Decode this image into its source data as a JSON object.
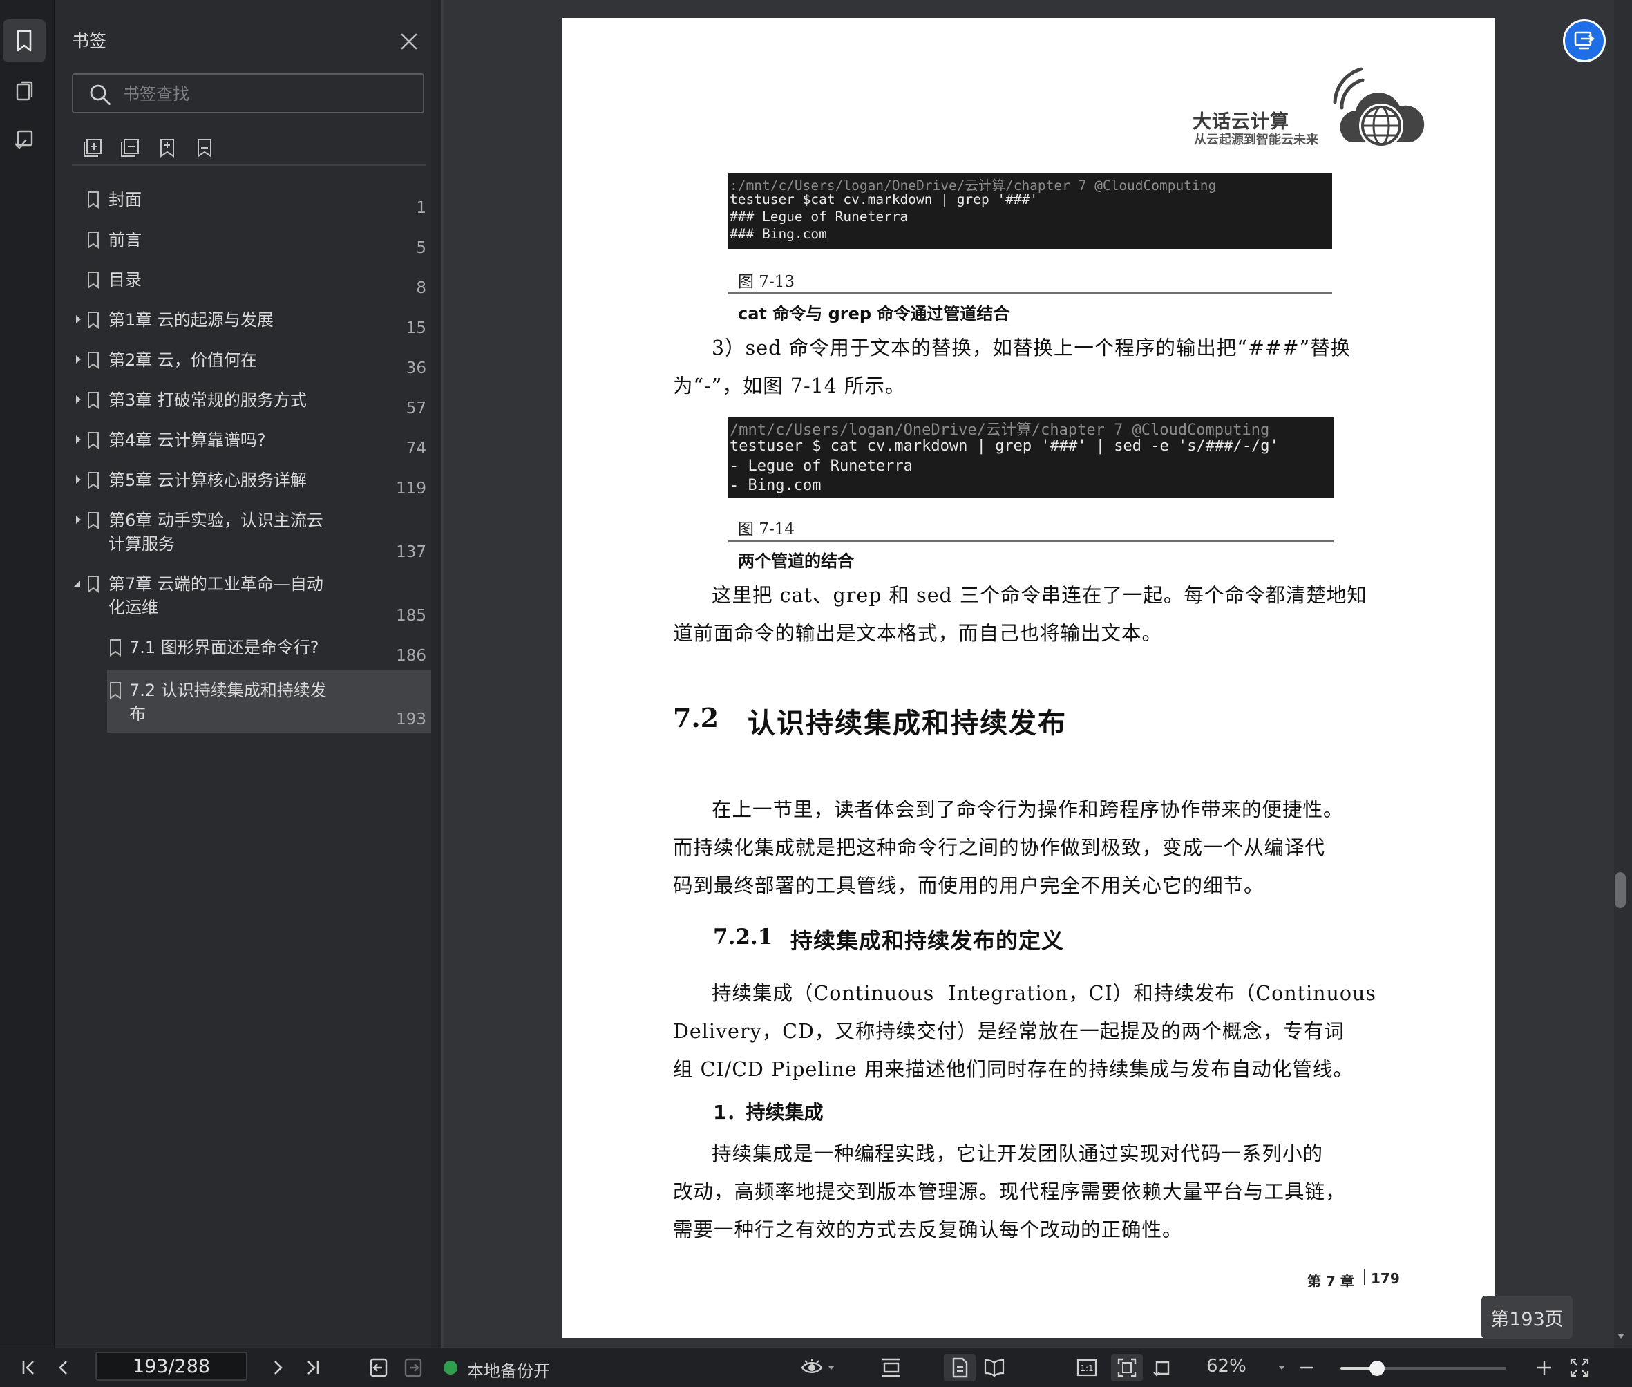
{
  "sidebar": {
    "title": "书签",
    "search_placeholder": "书签查找",
    "tools": [
      "expand-all-icon",
      "collapse-all-icon",
      "add-bookmark-icon",
      "bookmark-icon"
    ],
    "items": [
      {
        "label": "封面",
        "page": "1",
        "expandable": false
      },
      {
        "label": "前言",
        "page": "5",
        "expandable": false
      },
      {
        "label": "目录",
        "page": "8",
        "expandable": false
      },
      {
        "label": "第1章 云的起源与发展",
        "page": "15",
        "expandable": true
      },
      {
        "label": "第2章 云，价值何在",
        "page": "36",
        "expandable": true
      },
      {
        "label": "第3章 打破常规的服务方式",
        "page": "57",
        "expandable": true
      },
      {
        "label": "第4章 云计算靠谱吗?",
        "page": "74",
        "expandable": true
      },
      {
        "label": "第5章 云计算核心服务详解",
        "page": "119",
        "expandable": true
      },
      {
        "label": "第6章 动手实验，认识主流云\n计算服务",
        "page": "137",
        "expandable": true
      },
      {
        "label": "第7章 云端的工业革命—自动\n化运维",
        "page": "185",
        "expandable": true,
        "expanded": true
      },
      {
        "label": "7.1 图形界面还是命令行?",
        "page": "186",
        "child": true
      },
      {
        "label": "7.2 认识持续集成和持续发\n布",
        "page": "193",
        "child": true,
        "selected": true
      }
    ]
  },
  "document": {
    "logo_title": "大话云计算",
    "logo_subtitle": "从云起源到智能云未来",
    "terminal1": [
      ":/mnt/c/Users/logan/OneDrive/云计算/chapter 7 @CloudComputing",
      "testuser $cat cv.markdown | grep '###'",
      "### Legue of Runeterra",
      "### Bing.com"
    ],
    "fig1_no": "图 7-13",
    "fig1_caption": "cat 命令与 grep 命令通过管道结合",
    "para1": [
      "3）sed 命令用于文本的替换，如替换上一个程序的输出把“###”替换",
      "为“-”，如图 7-14 所示。"
    ],
    "terminal2": [
      "/mnt/c/Users/logan/OneDrive/云计算/chapter 7 @CloudComputing",
      "testuser $ cat cv.markdown | grep '###' | sed -e 's/###/-/g'",
      "- Legue of Runeterra",
      "- Bing.com"
    ],
    "fig2_no": "图 7-14",
    "fig2_caption": "两个管道的结合",
    "para2": [
      "这里把 cat、grep 和 sed 三个命令串连在了一起。每个命令都清楚地知",
      "道前面命令的输出是文本格式，而自己也将输出文本。"
    ],
    "section_number": "7.2",
    "section_title": "认识持续集成和持续发布",
    "para3": [
      "在上一节里，读者体会到了命令行为操作和跨程序协作带来的便捷性。",
      "而持续化集成就是把这种命令行之间的协作做到极致，变成一个从编译代",
      "码到最终部署的工具管线，而使用的用户完全不用关心它的细节。"
    ],
    "subsection_number": "7.2.1",
    "subsection_title": "持续集成和持续发布的定义",
    "para4": [
      "持续集成（Continuous  Integration，CI）和持续发布（Continuous",
      "Delivery，CD，又称持续交付）是经常放在一起提及的两个概念，专有词",
      "组 CI/CD Pipeline 用来描述他们同时存在的持续集成与发布自动化管线。"
    ],
    "item_heading": "1．持续集成",
    "para5": [
      "持续集成是一种编程实践，它让开发团队通过实现对代码一系列小的",
      "改动，高频率地提交到版本管理源。现代程序需要依赖大量平台与工具链，",
      "需要一种行之有效的方式去反复确认每个改动的正确性。"
    ],
    "footer_chapter": "第 7 章",
    "footer_page": "179"
  },
  "page_indicator": "第193页",
  "toolbar": {
    "page_value": "193/288",
    "backup_status": "本地备份开",
    "zoom": "62%",
    "zoom_fraction": 0.22
  },
  "colors": {
    "accent": "#1e6ee6",
    "status_ok": "#2f9e4f"
  }
}
